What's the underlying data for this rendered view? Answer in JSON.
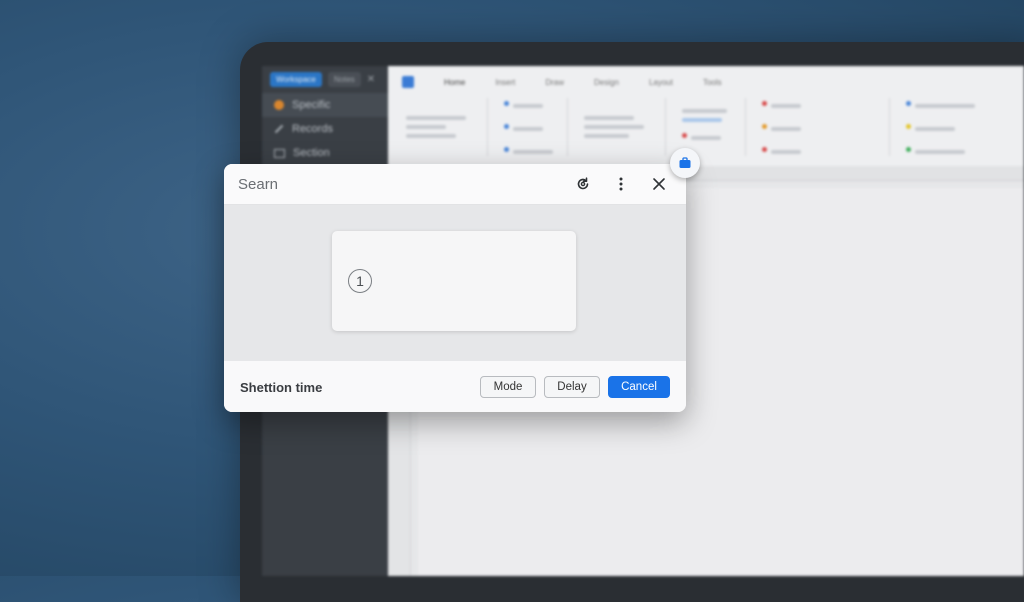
{
  "background_app": {
    "sidebar": {
      "top_pill": "Workspace",
      "second_pill": "Notes",
      "items": [
        {
          "label": "Specific"
        },
        {
          "label": "Records"
        },
        {
          "label": "Section"
        }
      ]
    },
    "ribbon_tabs": [
      "Home",
      "Insert",
      "Draw",
      "Design",
      "Layout",
      "Tools"
    ]
  },
  "dialog": {
    "title": "Searn",
    "body": {
      "step_number": "1"
    },
    "footer": {
      "label": "Shettion time",
      "buttons": {
        "mode": "Mode",
        "delay": "Delay",
        "cancel": "Cancel"
      }
    },
    "header_icons": [
      "refresh-icon",
      "more-vert-icon",
      "close-icon"
    ]
  },
  "corner_badge_icon": "briefcase-icon",
  "colors": {
    "primary": "#1a73e8",
    "backdrop": "#2f5577"
  }
}
